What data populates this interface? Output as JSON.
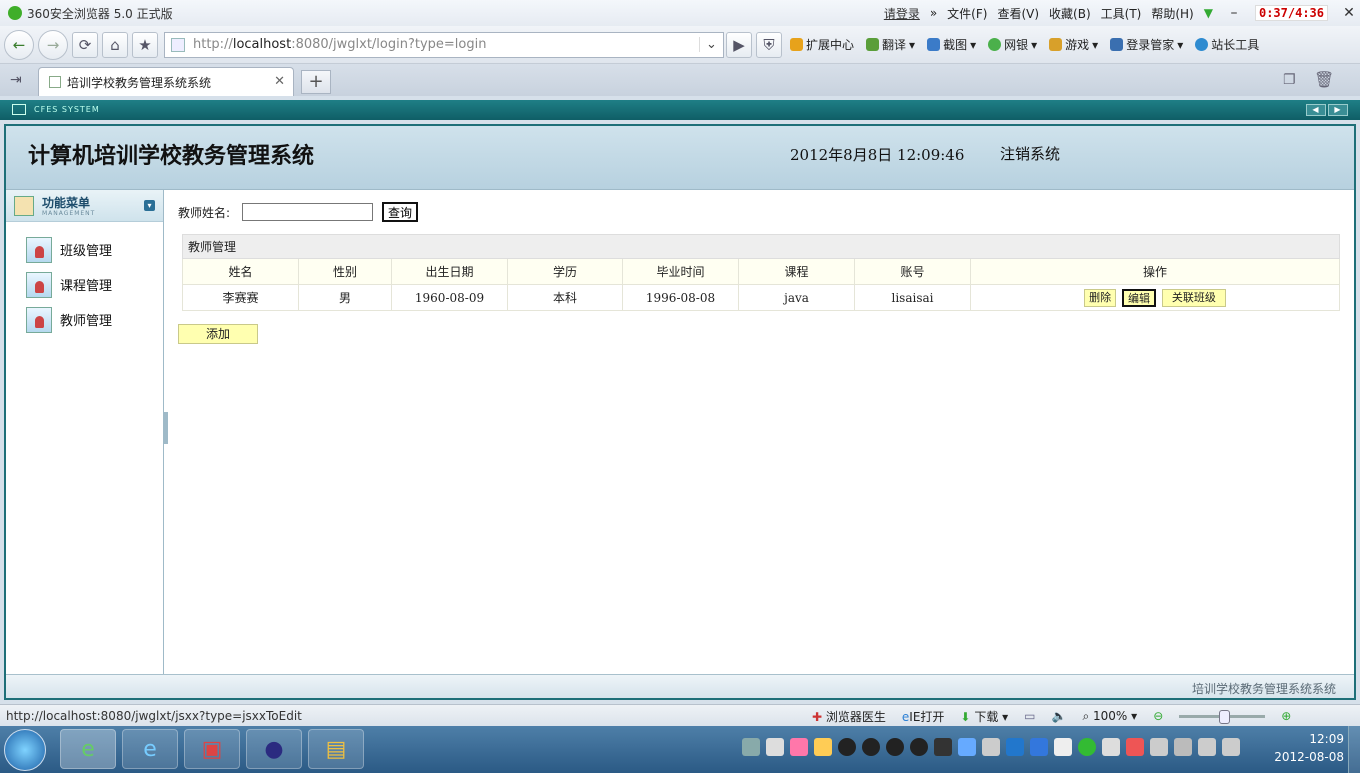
{
  "browser": {
    "title": "360安全浏览器 5.0 正式版",
    "login_link": "请登录",
    "menus": [
      "文件(F)",
      "查看(V)",
      "收藏(B)",
      "工具(T)",
      "帮助(H)"
    ],
    "timer": "0:37/4:36",
    "url_prefix": "http://",
    "url_host": "localhost",
    "url_rest": ":8080/jwglxt/login?type=login",
    "toolbar": [
      "扩展中心",
      "翻译",
      "截图",
      "网银",
      "游戏",
      "登录管家",
      "站长工具"
    ],
    "tab_title": "培训学校教务管理系统系统",
    "status_url": "http://localhost:8080/jwglxt/jsxx?type=jsxxToEdit",
    "status_items": [
      "浏览器医生",
      "IE打开",
      "下载"
    ],
    "zoom": "100%"
  },
  "app": {
    "banner": "CFES SYSTEM",
    "title": "计算机培训学校教务管理系统",
    "datetime": "2012年8月8日  12:09:46",
    "logout": "注销系统",
    "footer": "培训学校教务管理系统系统"
  },
  "sidebar": {
    "title": "功能菜单",
    "subtitle": "MANAGEMENT",
    "items": [
      {
        "label": "班级管理"
      },
      {
        "label": "课程管理"
      },
      {
        "label": "教师管理"
      }
    ]
  },
  "main": {
    "search_label": "教师姓名:",
    "search_value": "",
    "search_button": "查询",
    "table_caption": "教师管理",
    "columns": [
      "姓名",
      "性别",
      "出生日期",
      "学历",
      "毕业时间",
      "课程",
      "账号",
      "操作"
    ],
    "rows": [
      {
        "name": "李赛赛",
        "gender": "男",
        "birth": "1960-08-09",
        "education": "本科",
        "graduation": "1996-08-08",
        "course": "java",
        "account": "lisaisai"
      }
    ],
    "actions": [
      "删除",
      "编辑",
      "关联班级"
    ],
    "add_button": "添加"
  },
  "taskbar": {
    "time": "12:09",
    "date": "2012-08-08"
  },
  "colors": {
    "accent": "#1e6f78",
    "button_yellow": "#ffffb0",
    "header_bg": "#b7d1df"
  }
}
